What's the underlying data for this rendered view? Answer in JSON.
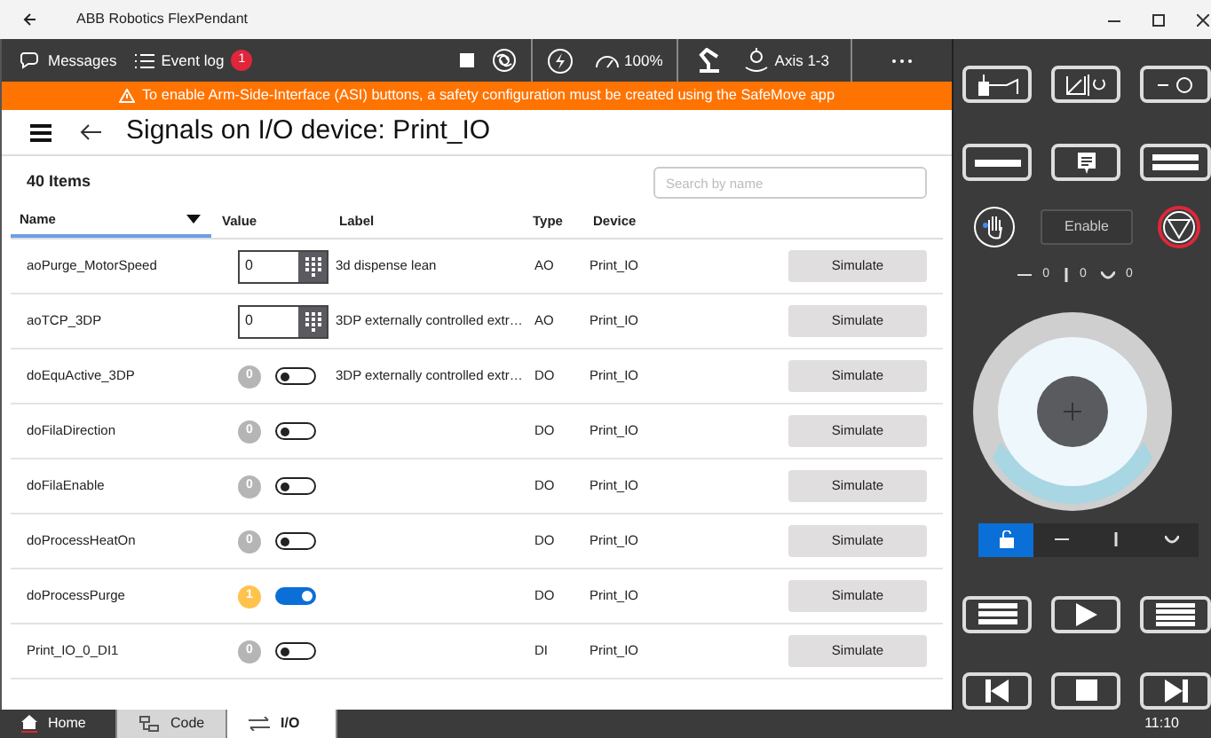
{
  "window": {
    "title": "ABB Robotics FlexPendant"
  },
  "toolbar": {
    "messages": "Messages",
    "event_log": "Event log",
    "event_count": "1",
    "speed": "100%",
    "axis": "Axis 1-3"
  },
  "banner": "To enable Arm-Side-Interface (ASI) buttons, a safety configuration must be created using the SafeMove app",
  "page_title": "Signals on I/O device: Print_IO",
  "item_count": "40 Items",
  "search": {
    "placeholder": "Search by name"
  },
  "table": {
    "columns": [
      "Name",
      "Value",
      "Label",
      "Type",
      "Device"
    ],
    "rows": [
      {
        "name": "aoPurge_MotorSpeed",
        "kind": "analog",
        "value": "0",
        "label": "3d dispense lean",
        "type": "AO",
        "device": "Print_IO",
        "action": "Simulate"
      },
      {
        "name": "aoTCP_3DP",
        "kind": "analog",
        "value": "0",
        "label": "3DP externally controlled extr…",
        "type": "AO",
        "device": "Print_IO",
        "action": "Simulate"
      },
      {
        "name": "doEquActive_3DP",
        "kind": "digital",
        "value": "0",
        "on": false,
        "label": "3DP externally controlled extr…",
        "type": "DO",
        "device": "Print_IO",
        "action": "Simulate"
      },
      {
        "name": "doFilaDirection",
        "kind": "digital",
        "value": "0",
        "on": false,
        "type": "DO",
        "device": "Print_IO",
        "action": "Simulate"
      },
      {
        "name": "doFilaEnable",
        "kind": "digital",
        "value": "0",
        "on": false,
        "type": "DO",
        "device": "Print_IO",
        "action": "Simulate"
      },
      {
        "name": "doProcessHeatOn",
        "kind": "digital",
        "value": "0",
        "on": false,
        "type": "DO",
        "device": "Print_IO",
        "action": "Simulate"
      },
      {
        "name": "doProcessPurge",
        "kind": "digital",
        "value": "1",
        "on": true,
        "type": "DO",
        "device": "Print_IO",
        "action": "Simulate"
      },
      {
        "name": "Print_IO_0_DI1",
        "kind": "digital",
        "value": "0",
        "on": false,
        "type": "DI",
        "device": "Print_IO",
        "action": "Simulate"
      }
    ]
  },
  "bottom_tabs": [
    {
      "label": "Home",
      "selected": false
    },
    {
      "label": "Code",
      "selected": false
    },
    {
      "label": "I/O",
      "selected": true
    }
  ],
  "clock": "11:10",
  "jog_panel": {
    "enable": "Enable",
    "readings": [
      "0",
      "0",
      "0"
    ],
    "modes": [
      {
        "kind": "lock",
        "selected": true
      },
      {
        "kind": "horizontal",
        "selected": false
      },
      {
        "kind": "vertical",
        "selected": false
      },
      {
        "kind": "rotate",
        "selected": false
      }
    ]
  }
}
